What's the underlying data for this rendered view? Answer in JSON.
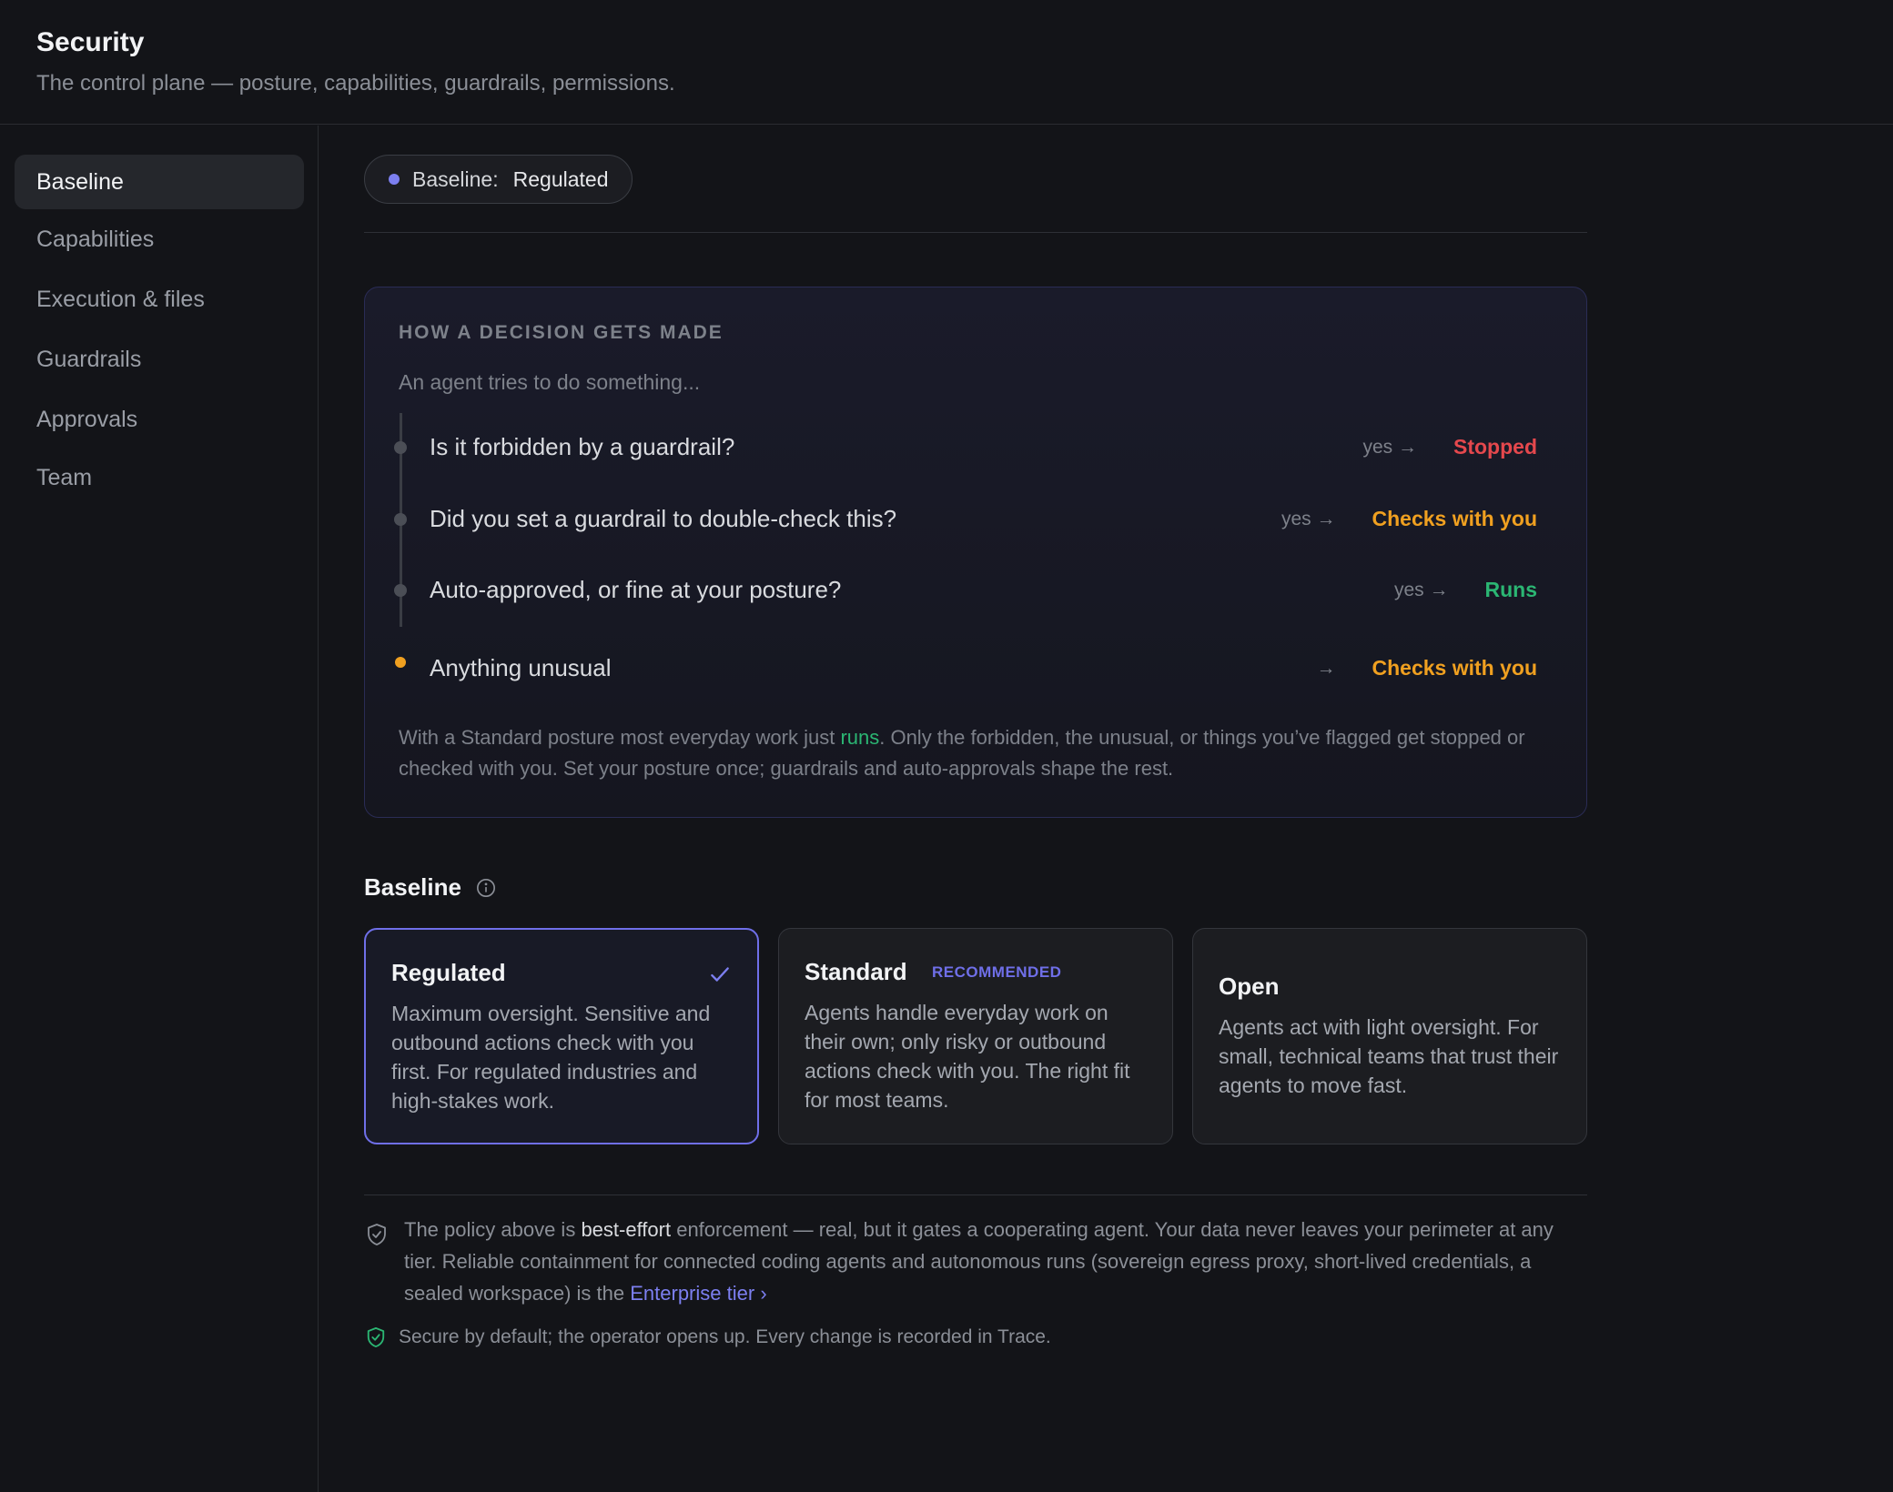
{
  "header": {
    "title": "Security",
    "subtitle": "The control plane — posture, capabilities, guardrails, permissions."
  },
  "sidebar": {
    "items": [
      {
        "label": "Baseline",
        "active": true
      },
      {
        "label": "Capabilities",
        "active": false
      },
      {
        "label": "Execution & files",
        "active": false
      },
      {
        "label": "Guardrails",
        "active": false
      },
      {
        "label": "Approvals",
        "active": false
      },
      {
        "label": "Team",
        "active": false
      }
    ]
  },
  "pill": {
    "label": "Baseline:",
    "value": "Regulated",
    "dot_color": "#7c7ff0"
  },
  "decision": {
    "heading": "HOW A DECISION GETS MADE",
    "intro": "An agent tries to do something...",
    "steps": [
      {
        "question": "Is it forbidden by a guardrail?",
        "condition": "yes",
        "arrow": "→",
        "outcome": "Stopped",
        "color": "#e5484d"
      },
      {
        "question": "Did you set a guardrail to double-check this?",
        "condition": "yes",
        "arrow": "→",
        "outcome": "Checks with you",
        "color": "#f0a020"
      },
      {
        "question": "Auto-approved, or fine at your posture?",
        "condition": "yes",
        "arrow": "→",
        "outcome": "Runs",
        "color": "#2bb673"
      },
      {
        "question": "Anything unusual",
        "condition": "",
        "arrow": "→",
        "outcome": "Checks with you",
        "color": "#f0a020"
      }
    ],
    "footer_pre": "With a Standard posture most everyday work just ",
    "footer_highlight": "runs",
    "footer_post": ". Only the forbidden, the unusual, or things you’ve flagged get stopped or checked with you. Set your posture once; guardrails and auto-approvals shape the rest."
  },
  "baseline": {
    "label": "Baseline",
    "info_icon": "info-icon",
    "options": [
      {
        "title": "Regulated",
        "badge": "",
        "selected": true,
        "description": "Maximum oversight. Sensitive and outbound actions check with you first. For regulated industries and high-stakes work."
      },
      {
        "title": "Standard",
        "badge": "RECOMMENDED",
        "selected": false,
        "description": "Agents handle everyday work on their own; only risky or outbound actions check with you. The right fit for most teams."
      },
      {
        "title": "Open",
        "badge": "",
        "selected": false,
        "description": "Agents act with light oversight. For small, technical teams that trust their agents to move fast."
      }
    ]
  },
  "note": {
    "icon": "shield-icon",
    "pre": "The policy above is ",
    "strong": "best-effort",
    "mid": " enforcement — real, but it gates a cooperating agent. Your data never leaves your perimeter at any tier. Reliable containment for connected coding agents and autonomous runs (sovereign egress proxy, short-lived credentials, a sealed workspace) is the ",
    "link": "Enterprise tier",
    "link_chevron": "›"
  },
  "secure": {
    "icon": "shield-check-icon",
    "text": "Secure by default; the operator opens up. Every change is recorded in Trace."
  },
  "colors": {
    "accent": "#7c7ff0",
    "danger": "#e5484d",
    "warning": "#f0a020",
    "success": "#2bb673"
  }
}
